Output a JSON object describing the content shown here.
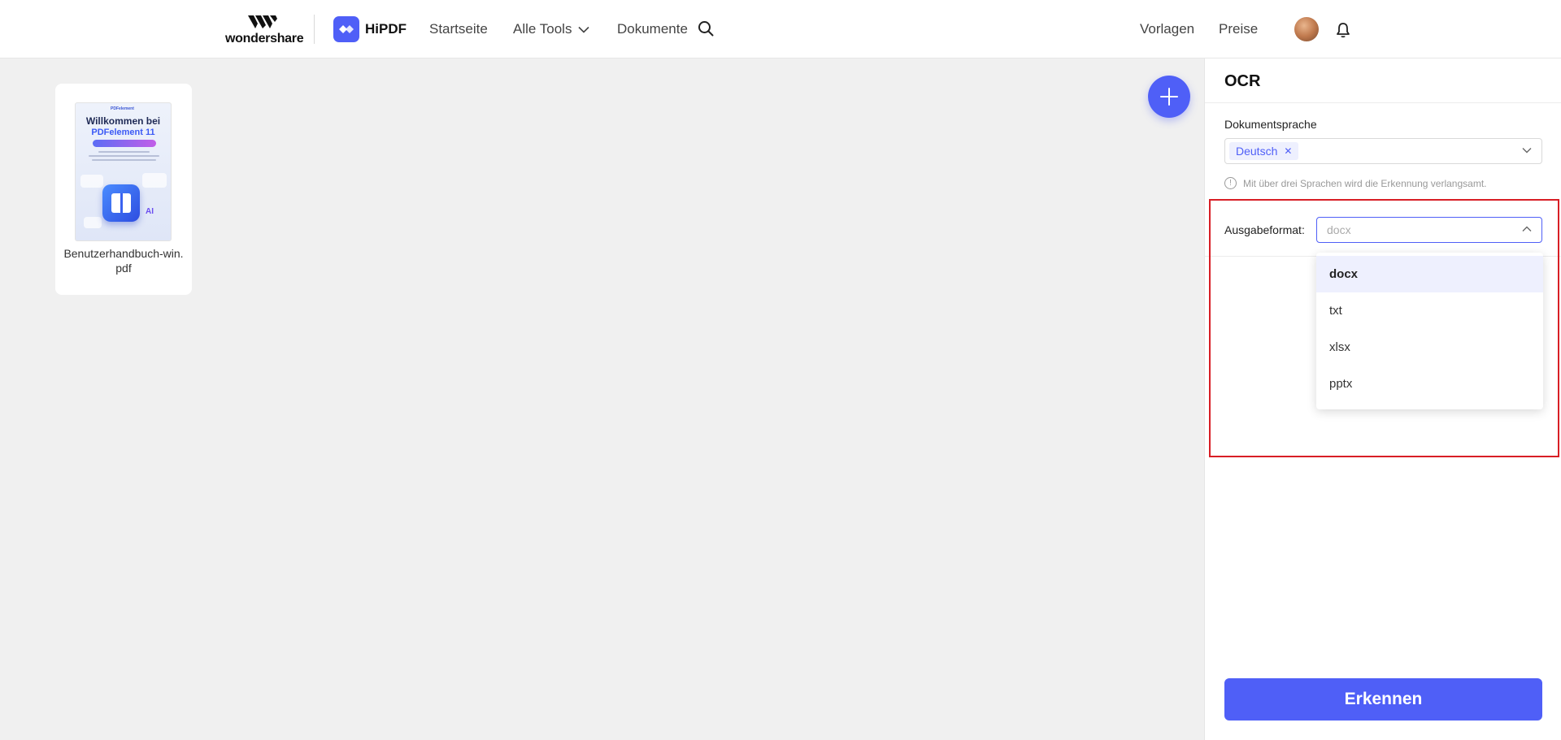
{
  "header": {
    "brand": "wondershare",
    "product": "HiPDF",
    "nav": {
      "home": "Startseite",
      "tools": "Alle Tools",
      "documents": "Dokumente",
      "templates": "Vorlagen",
      "pricing": "Preise"
    }
  },
  "files": [
    {
      "name": "Benutzerhandbuch-win.pdf",
      "thumbnail": {
        "brand": "PDFelement",
        "title_line1": "Willkommen bei",
        "title_line2": "PDFelement 11",
        "badge": "AI"
      }
    }
  ],
  "panel": {
    "title": "OCR",
    "language": {
      "label": "Dokumentsprache",
      "selected": [
        "Deutsch"
      ],
      "hint": "Mit über drei Sprachen wird die Erkennung verlangsamt."
    },
    "output": {
      "label": "Ausgabeformat:",
      "value": "docx",
      "options": [
        "docx",
        "txt",
        "xlsx",
        "pptx"
      ],
      "selected_option": "docx"
    },
    "submit_label": "Erkennen"
  },
  "colors": {
    "accent": "#4f5ff7",
    "highlight_border": "#d81e25",
    "selected_option_bg": "#eef0fe"
  },
  "icons": {
    "search": "search-icon",
    "bell": "bell-icon",
    "add": "plus-icon",
    "dropdown_open": "chevron-up-icon",
    "dropdown_closed": "chevron-down-icon",
    "info": "info-icon",
    "remove_tag": "close-icon"
  }
}
